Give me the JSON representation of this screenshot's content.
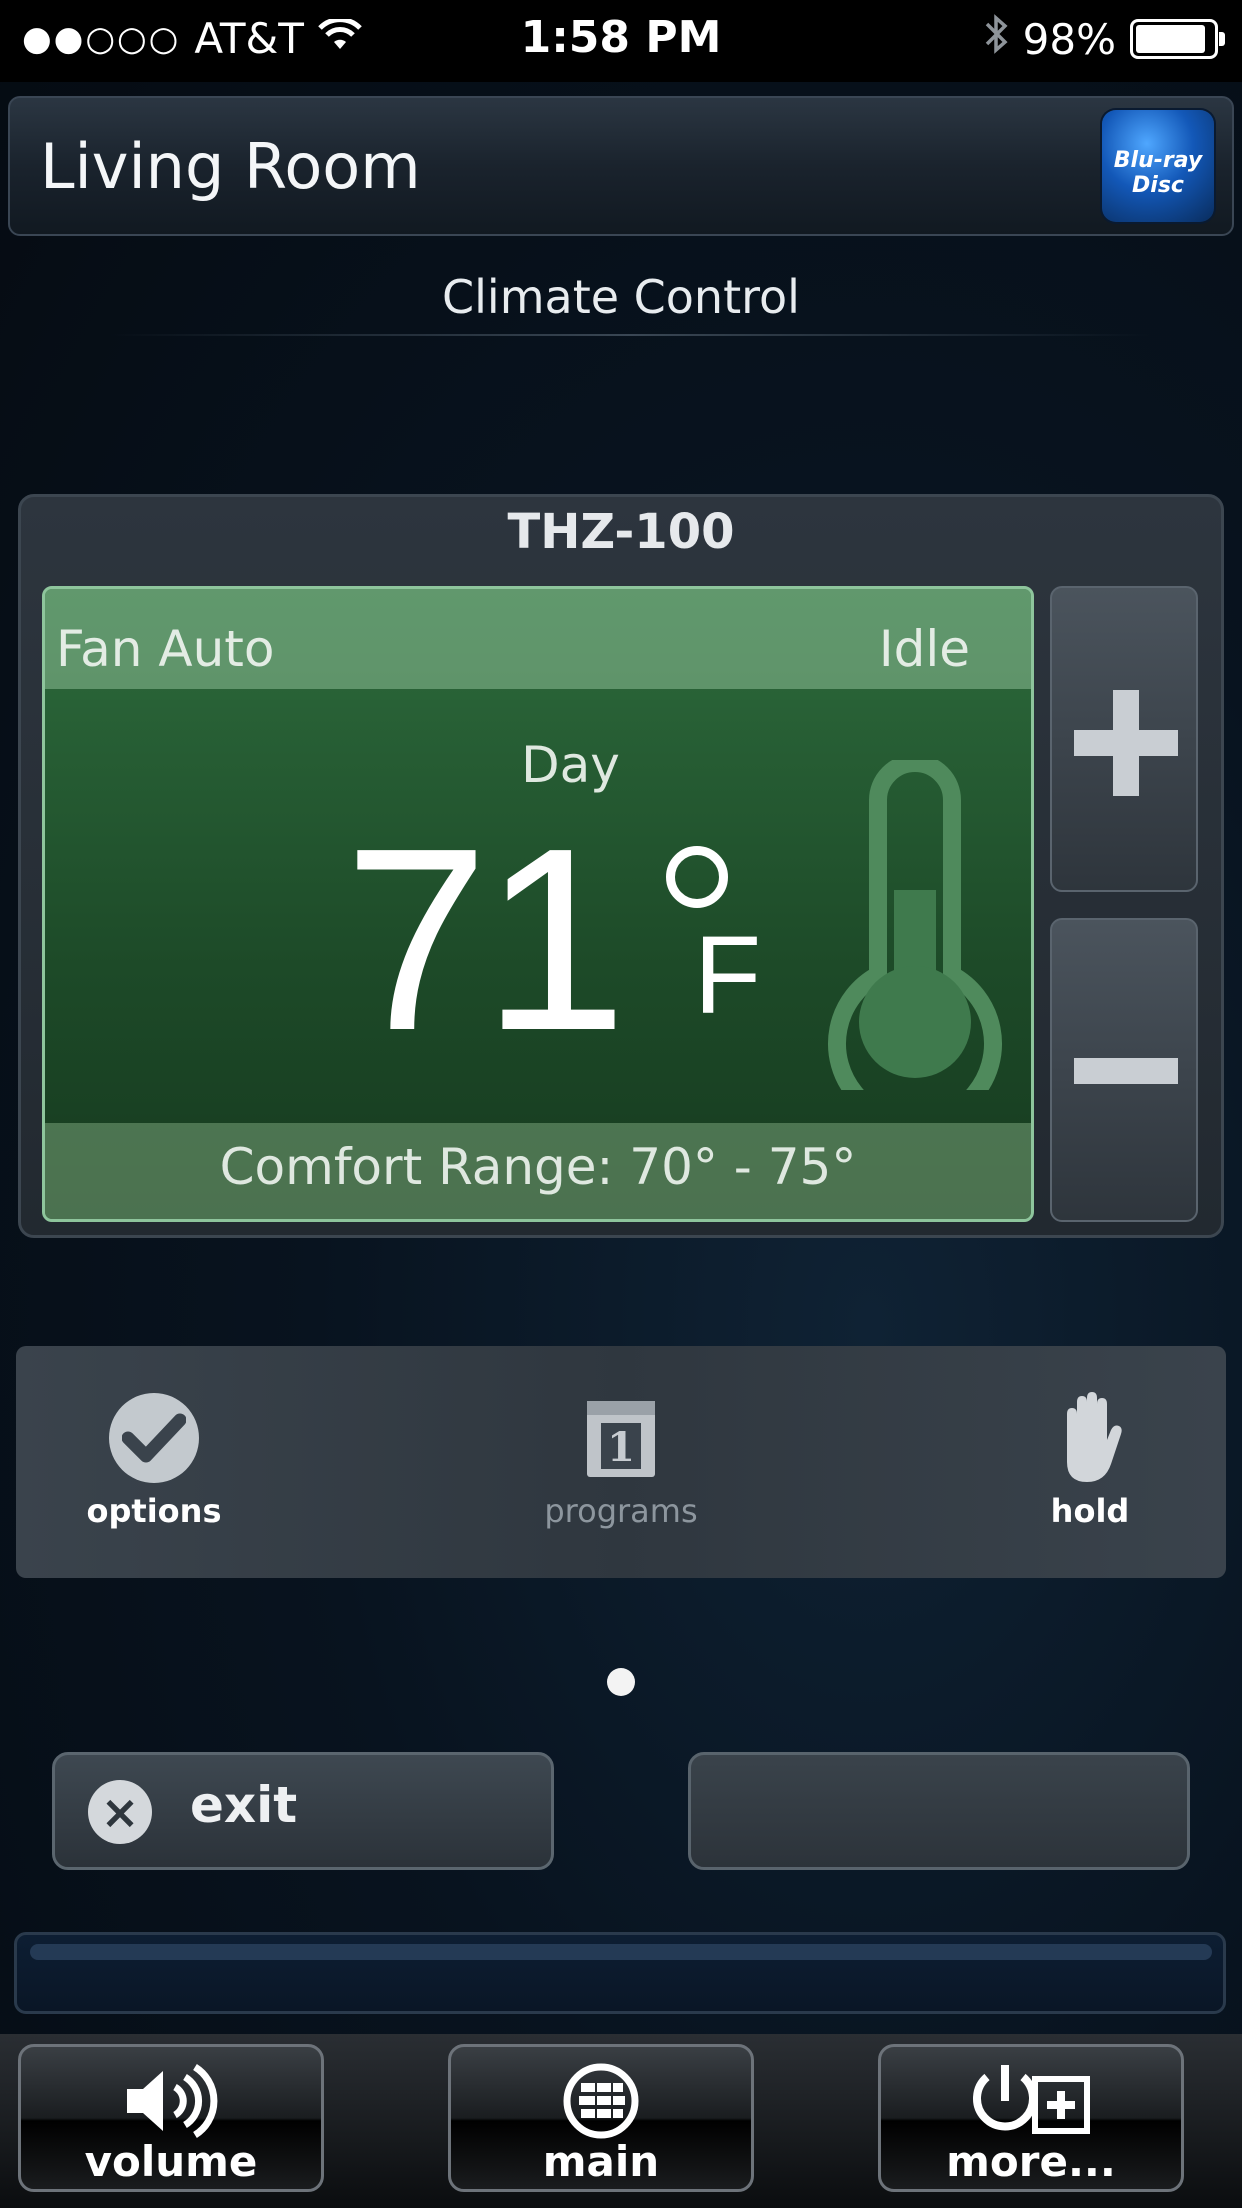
{
  "status_bar": {
    "signal_dots": "●●○○○",
    "carrier": "AT&T",
    "time": "1:58 PM",
    "battery_text": "98%",
    "battery_level": 0.98,
    "icons": [
      "wifi-icon",
      "bluetooth-icon",
      "battery-icon"
    ]
  },
  "header": {
    "title": "Living Room",
    "source_logo_text": "Blu-ray Disc",
    "source_icon": "bluray-icon"
  },
  "subtitle": "Climate Control",
  "thermostat": {
    "model": "THZ-100",
    "fan_mode": "Fan Auto",
    "state": "Idle",
    "period": "Day",
    "temperature": "71",
    "unit": "F",
    "comfort_range": "Comfort Range: 70° - 75°",
    "up_icon": "plus-icon",
    "down_icon": "minus-icon"
  },
  "actions": [
    {
      "label": "options",
      "icon": "check-icon"
    },
    {
      "label": "programs",
      "icon": "calendar-icon"
    },
    {
      "label": "hold",
      "icon": "hand-icon"
    }
  ],
  "exit_button": {
    "label": "exit",
    "icon": "close-icon"
  },
  "tabs": [
    {
      "label": "volume",
      "icon": "speaker-icon"
    },
    {
      "label": "main",
      "icon": "grid-icon"
    },
    {
      "label": "more...",
      "icon": "power-plus-icon"
    }
  ],
  "colors": {
    "display_green": "#1d4a28",
    "display_border": "#8ec59c",
    "programs_label": "#8d969e"
  }
}
